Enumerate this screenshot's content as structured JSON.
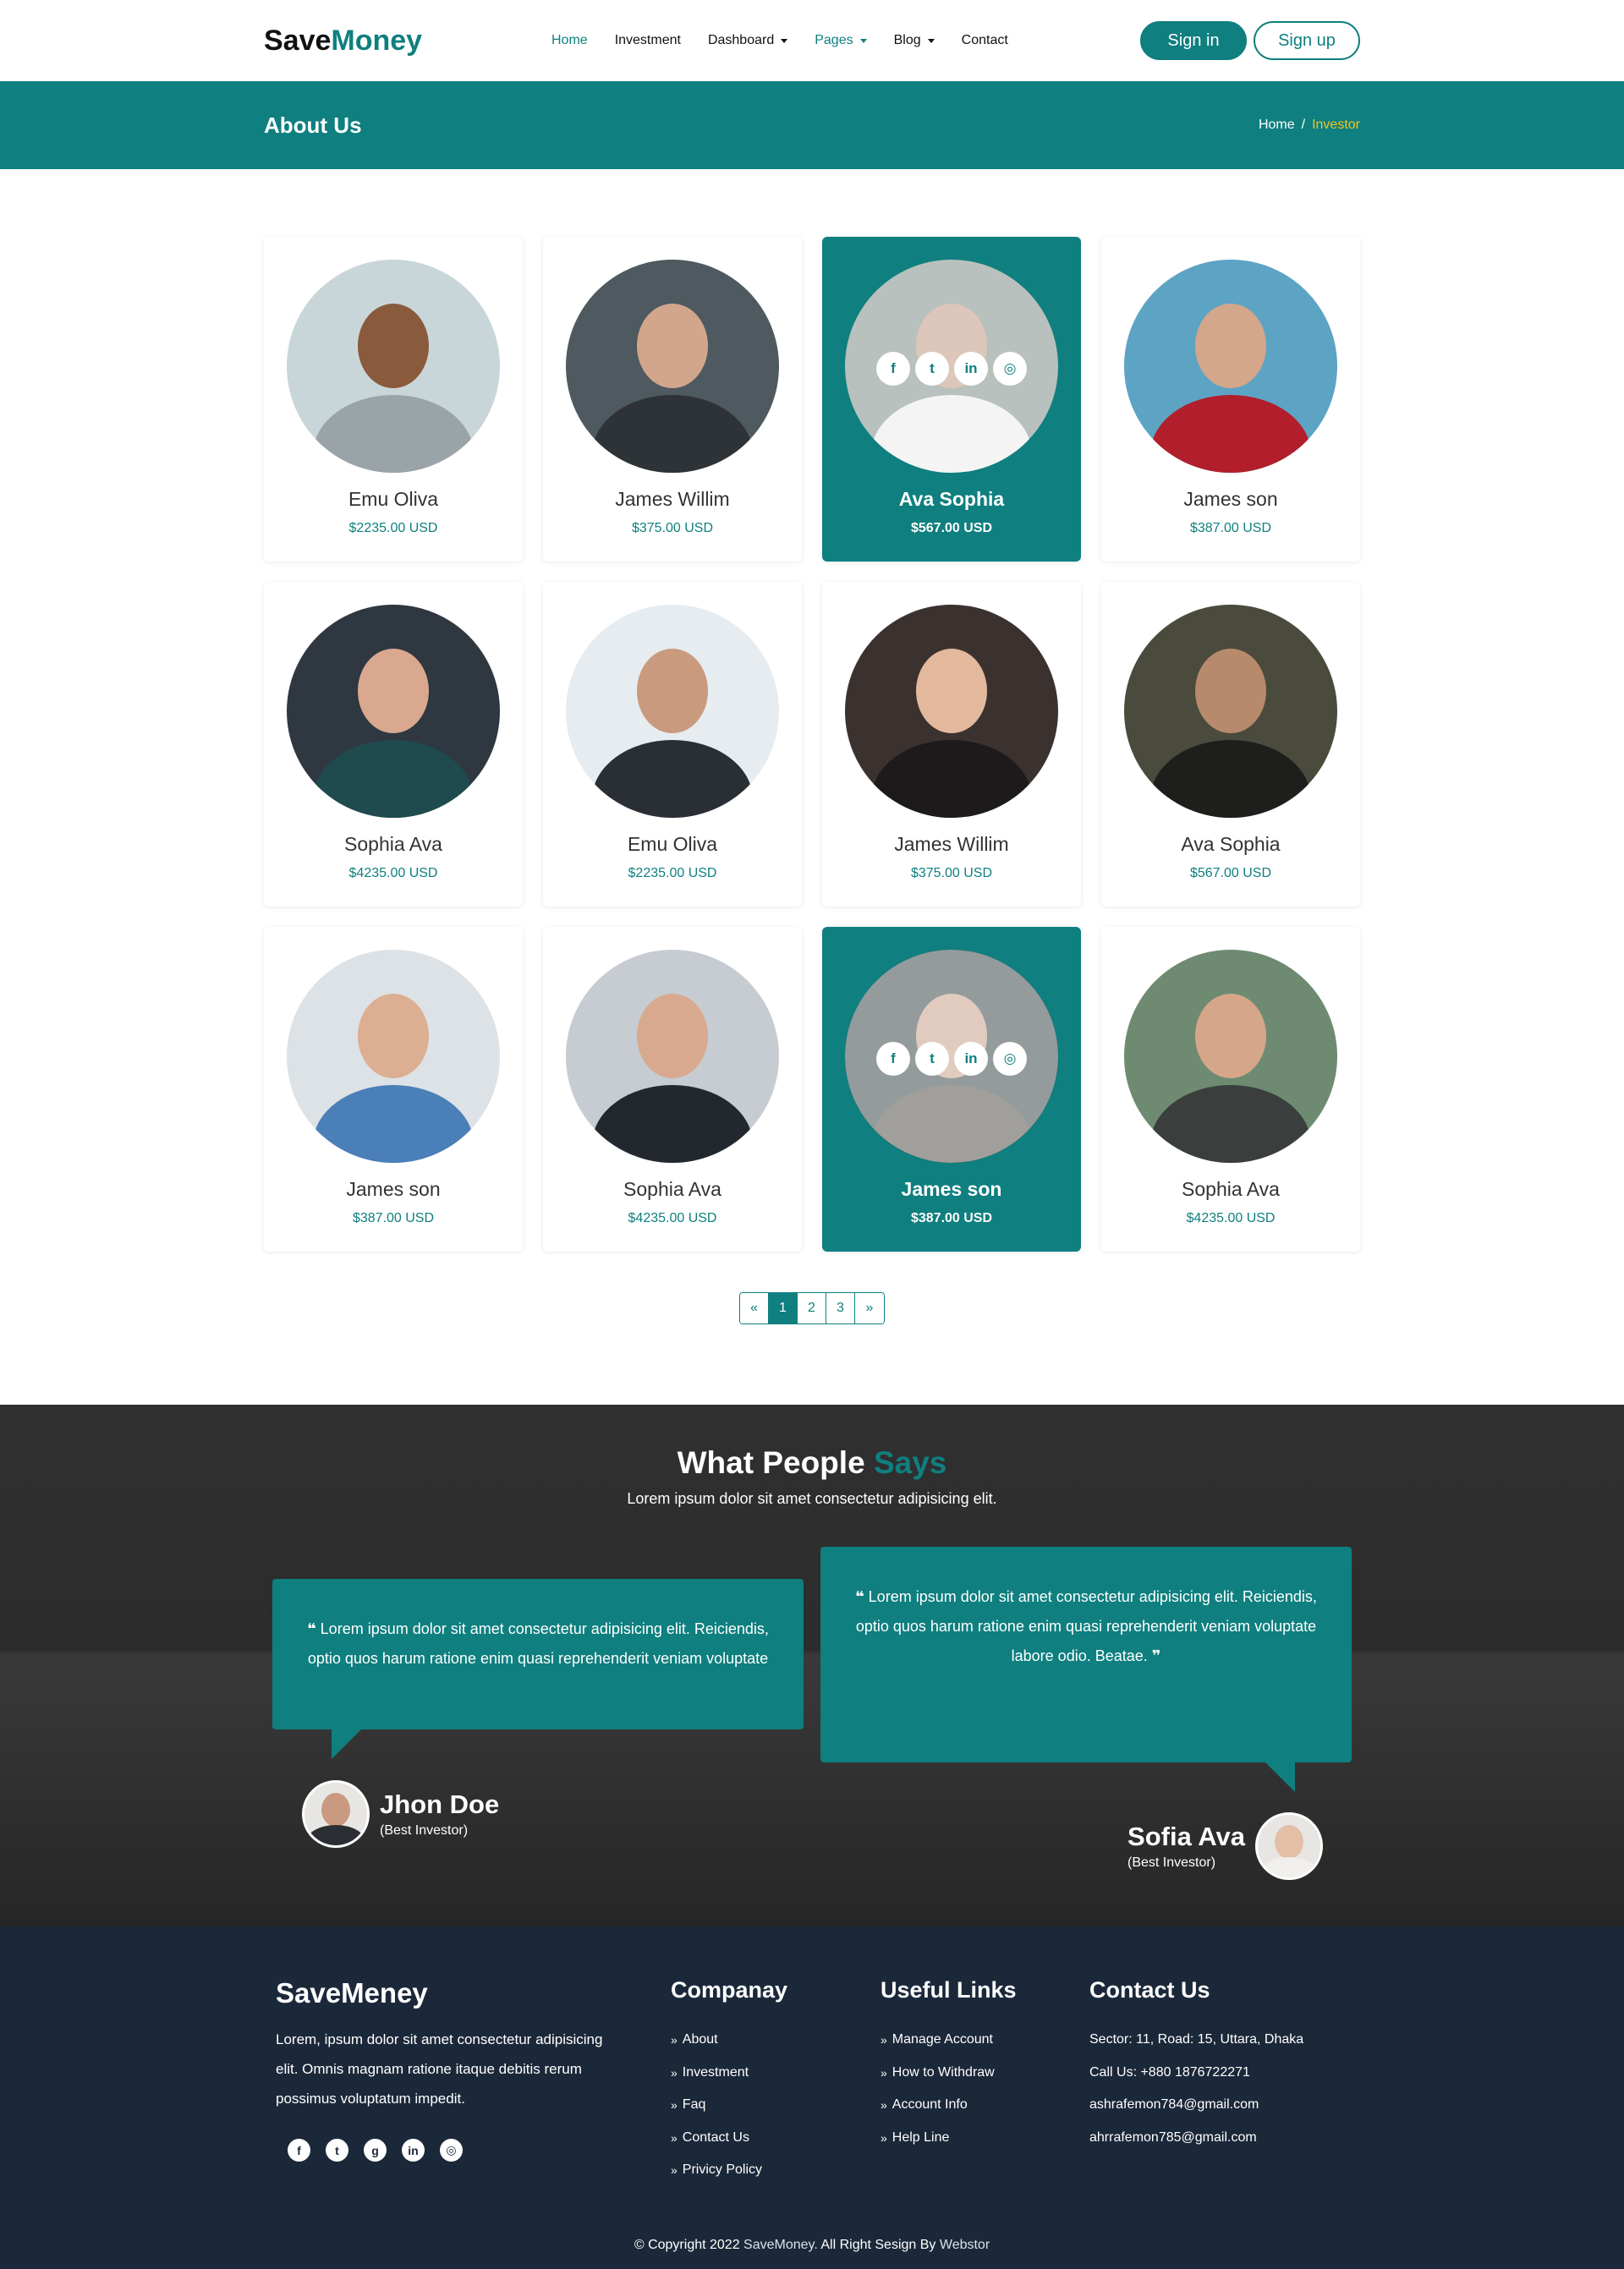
{
  "nav": {
    "logo_part1": "Save",
    "logo_part2": "Money",
    "items": [
      "Home",
      "Investment",
      "Dashboard",
      "Pages",
      "Blog",
      "Contact"
    ],
    "sign_in": "Sign in",
    "sign_up": "Sign up"
  },
  "banner": {
    "title": "About Us",
    "crumb_home": "Home",
    "crumb_sep": "/",
    "crumb_current": "Investor"
  },
  "cards": [
    {
      "name": "Emu Oliva",
      "price": "$2235.00 USD"
    },
    {
      "name": "James Willim",
      "price": "$375.00 USD"
    },
    {
      "name": "Ava Sophia",
      "price": "$567.00 USD"
    },
    {
      "name": "James son",
      "price": "$387.00 USD"
    },
    {
      "name": "Sophia Ava",
      "price": "$4235.00 USD"
    },
    {
      "name": "Emu Oliva",
      "price": "$2235.00 USD"
    },
    {
      "name": "James Willim",
      "price": "$375.00 USD"
    },
    {
      "name": "Ava Sophia",
      "price": "$567.00 USD"
    },
    {
      "name": "James son",
      "price": "$387.00 USD"
    },
    {
      "name": "Sophia Ava",
      "price": "$4235.00 USD"
    },
    {
      "name": "James son",
      "price": "$387.00 USD"
    },
    {
      "name": "Sophia Ava",
      "price": "$4235.00 USD"
    }
  ],
  "social_icons": [
    "facebook-icon",
    "twitter-icon",
    "linkedin-icon",
    "instagram-icon"
  ],
  "pagination": {
    "prev": "«",
    "pages": [
      "1",
      "2",
      "3"
    ],
    "next": "»",
    "active": "1"
  },
  "testimonials": {
    "heading_part1": "What People",
    "heading_part2": "Says",
    "sub": "Lorem ipsum dolor sit amet consectetur adipisicing elit.",
    "quote": "Lorem ipsum dolor sit amet consectetur adipisicing elit. Reiciendis, optio quos harum ratione enim quasi reprehenderit veniam voluptate labore odio. Beatae.",
    "people": [
      {
        "name": "Jhon Doe",
        "role": "(Best Investor)"
      },
      {
        "name": "Sofia Ava",
        "role": "(Best Investor)"
      }
    ]
  },
  "footer": {
    "brand": "SaveMeney",
    "about": "Lorem, ipsum dolor sit amet consectetur adipisicing elit. Omnis magnam ratione itaque debitis rerum possimus voluptatum impedit.",
    "company_title": "Companay",
    "company_links": [
      "About",
      "Investment",
      "Faq",
      "Contact Us",
      "Privicy Policy"
    ],
    "useful_title": "Useful Links",
    "useful_links": [
      "Manage Account",
      "How to Withdraw",
      "Account Info",
      "Help Line"
    ],
    "contact_title": "Contact Us",
    "contact_lines": [
      "Sector: 11, Road: 15, Uttara, Dhaka",
      "Call Us: +880 1876722271",
      "ashrafemon784@gmail.com",
      "ahrrafemon785@gmail.com"
    ],
    "copyright_prefix": "© Copyright 2022",
    "copyright_brand": "SaveMoney.",
    "copyright_mid": "All Right Sesign By",
    "copyright_author": "Webstor"
  },
  "colors": {
    "accent": "#0f7f7f",
    "highlight": "#f3c623",
    "footer": "#1b2839"
  }
}
